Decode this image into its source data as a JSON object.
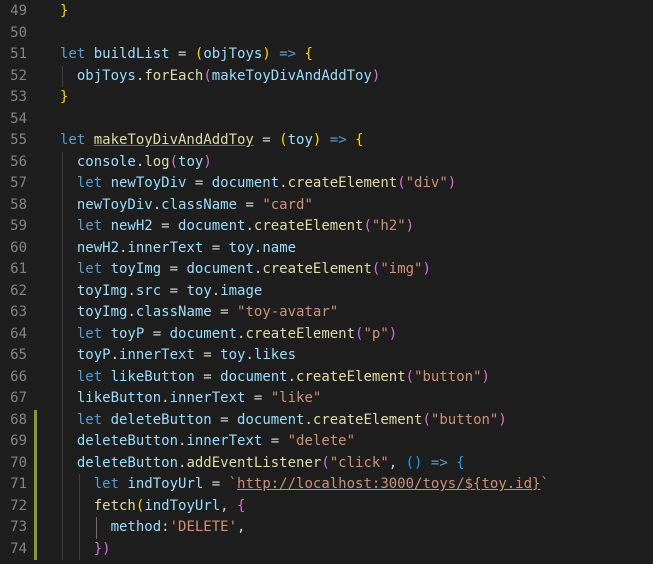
{
  "editor": {
    "lines": [
      {
        "num": "49",
        "top": "}",
        "parts": [
          [
            "br1",
            "}"
          ]
        ]
      },
      {
        "num": "50",
        "parts": []
      },
      {
        "num": "51",
        "parts": [
          [
            "kw",
            "let "
          ],
          [
            "var",
            "buildList"
          ],
          [
            "op",
            " = "
          ],
          [
            "br1",
            "("
          ],
          [
            "var",
            "objToys"
          ],
          [
            "br1",
            ")"
          ],
          [
            "op",
            " "
          ],
          [
            "kw",
            "=>"
          ],
          [
            "op",
            " "
          ],
          [
            "br1",
            "{"
          ]
        ]
      },
      {
        "num": "52",
        "parts": [
          [
            "op",
            "  "
          ],
          [
            "var",
            "objToys"
          ],
          [
            "op",
            "."
          ],
          [
            "fn",
            "forEach"
          ],
          [
            "br2",
            "("
          ],
          [
            "var",
            "makeToyDivAndAddToy"
          ],
          [
            "br2",
            ")"
          ]
        ]
      },
      {
        "num": "53",
        "parts": [
          [
            "br1",
            "}"
          ]
        ]
      },
      {
        "num": "54",
        "parts": []
      },
      {
        "num": "55",
        "parts": [
          [
            "kw",
            "let "
          ],
          [
            "fn ul",
            "makeToyDivAndAddToy"
          ],
          [
            "op",
            " = "
          ],
          [
            "br1",
            "("
          ],
          [
            "var",
            "toy"
          ],
          [
            "br1",
            ")"
          ],
          [
            "op",
            " "
          ],
          [
            "kw",
            "=>"
          ],
          [
            "op",
            " "
          ],
          [
            "br1",
            "{"
          ]
        ]
      },
      {
        "num": "56",
        "parts": [
          [
            "op",
            "  "
          ],
          [
            "var",
            "console"
          ],
          [
            "op",
            "."
          ],
          [
            "fn",
            "log"
          ],
          [
            "br2",
            "("
          ],
          [
            "var",
            "toy"
          ],
          [
            "br2",
            ")"
          ]
        ]
      },
      {
        "num": "57",
        "parts": [
          [
            "op",
            "  "
          ],
          [
            "kw",
            "let "
          ],
          [
            "var",
            "newToyDiv"
          ],
          [
            "op",
            " = "
          ],
          [
            "var",
            "document"
          ],
          [
            "op",
            "."
          ],
          [
            "fn",
            "createElement"
          ],
          [
            "br2",
            "("
          ],
          [
            "str",
            "\"div\""
          ],
          [
            "br2",
            ")"
          ]
        ]
      },
      {
        "num": "58",
        "parts": [
          [
            "op",
            "  "
          ],
          [
            "var",
            "newToyDiv"
          ],
          [
            "op",
            "."
          ],
          [
            "var",
            "className"
          ],
          [
            "op",
            " = "
          ],
          [
            "str",
            "\"card\""
          ]
        ]
      },
      {
        "num": "59",
        "parts": [
          [
            "op",
            "  "
          ],
          [
            "kw",
            "let "
          ],
          [
            "var",
            "newH2"
          ],
          [
            "op",
            " = "
          ],
          [
            "var",
            "document"
          ],
          [
            "op",
            "."
          ],
          [
            "fn",
            "createElement"
          ],
          [
            "br2",
            "("
          ],
          [
            "str",
            "\"h2\""
          ],
          [
            "br2",
            ")"
          ]
        ]
      },
      {
        "num": "60",
        "parts": [
          [
            "op",
            "  "
          ],
          [
            "var",
            "newH2"
          ],
          [
            "op",
            "."
          ],
          [
            "var",
            "innerText"
          ],
          [
            "op",
            " = "
          ],
          [
            "var",
            "toy"
          ],
          [
            "op",
            "."
          ],
          [
            "var",
            "name"
          ]
        ]
      },
      {
        "num": "61",
        "parts": [
          [
            "op",
            "  "
          ],
          [
            "kw",
            "let "
          ],
          [
            "var",
            "toyImg"
          ],
          [
            "op",
            " = "
          ],
          [
            "var",
            "document"
          ],
          [
            "op",
            "."
          ],
          [
            "fn",
            "createElement"
          ],
          [
            "br2",
            "("
          ],
          [
            "str",
            "\"img\""
          ],
          [
            "br2",
            ")"
          ]
        ]
      },
      {
        "num": "62",
        "parts": [
          [
            "op",
            "  "
          ],
          [
            "var",
            "toyImg"
          ],
          [
            "op",
            "."
          ],
          [
            "var",
            "src"
          ],
          [
            "op",
            " = "
          ],
          [
            "var",
            "toy"
          ],
          [
            "op",
            "."
          ],
          [
            "var",
            "image"
          ]
        ]
      },
      {
        "num": "63",
        "parts": [
          [
            "op",
            "  "
          ],
          [
            "var",
            "toyImg"
          ],
          [
            "op",
            "."
          ],
          [
            "var",
            "className"
          ],
          [
            "op",
            " = "
          ],
          [
            "str",
            "\"toy-avatar\""
          ]
        ]
      },
      {
        "num": "64",
        "parts": [
          [
            "op",
            "  "
          ],
          [
            "kw",
            "let "
          ],
          [
            "var",
            "toyP"
          ],
          [
            "op",
            " = "
          ],
          [
            "var",
            "document"
          ],
          [
            "op",
            "."
          ],
          [
            "fn",
            "createElement"
          ],
          [
            "br2",
            "("
          ],
          [
            "str",
            "\"p\""
          ],
          [
            "br2",
            ")"
          ]
        ]
      },
      {
        "num": "65",
        "parts": [
          [
            "op",
            "  "
          ],
          [
            "var",
            "toyP"
          ],
          [
            "op",
            "."
          ],
          [
            "var",
            "innerText"
          ],
          [
            "op",
            " = "
          ],
          [
            "var",
            "toy"
          ],
          [
            "op",
            "."
          ],
          [
            "var",
            "likes"
          ]
        ]
      },
      {
        "num": "66",
        "parts": [
          [
            "op",
            "  "
          ],
          [
            "kw",
            "let "
          ],
          [
            "var",
            "likeButton"
          ],
          [
            "op",
            " = "
          ],
          [
            "var",
            "document"
          ],
          [
            "op",
            "."
          ],
          [
            "fn",
            "createElement"
          ],
          [
            "br2",
            "("
          ],
          [
            "str",
            "\"button\""
          ],
          [
            "br2",
            ")"
          ]
        ]
      },
      {
        "num": "67",
        "parts": [
          [
            "op",
            "  "
          ],
          [
            "var",
            "likeButton"
          ],
          [
            "op",
            "."
          ],
          [
            "var",
            "innerText"
          ],
          [
            "op",
            " = "
          ],
          [
            "str",
            "\"like\""
          ]
        ]
      },
      {
        "num": "68",
        "parts": [
          [
            "op",
            "  "
          ],
          [
            "kw",
            "let "
          ],
          [
            "var",
            "deleteButton"
          ],
          [
            "op",
            " = "
          ],
          [
            "var",
            "document"
          ],
          [
            "op",
            "."
          ],
          [
            "fn",
            "createElement"
          ],
          [
            "br2",
            "("
          ],
          [
            "str",
            "\"button\""
          ],
          [
            "br2",
            ")"
          ]
        ]
      },
      {
        "num": "69",
        "parts": [
          [
            "op",
            "  "
          ],
          [
            "var",
            "deleteButton"
          ],
          [
            "op",
            "."
          ],
          [
            "var",
            "innerText"
          ],
          [
            "op",
            " = "
          ],
          [
            "str",
            "\"delete\""
          ]
        ]
      },
      {
        "num": "70",
        "parts": [
          [
            "op",
            "  "
          ],
          [
            "var",
            "deleteButton"
          ],
          [
            "op",
            "."
          ],
          [
            "fn",
            "addEventListener"
          ],
          [
            "br2",
            "("
          ],
          [
            "str",
            "\"click\""
          ],
          [
            "op",
            ", "
          ],
          [
            "br3",
            "()"
          ],
          [
            "op",
            " "
          ],
          [
            "kw",
            "=>"
          ],
          [
            "op",
            " "
          ],
          [
            "br3",
            "{"
          ]
        ]
      },
      {
        "num": "71",
        "parts": [
          [
            "op",
            "    "
          ],
          [
            "kw",
            "let "
          ],
          [
            "var",
            "indToyUrl"
          ],
          [
            "op",
            " = "
          ],
          [
            "str",
            "`"
          ],
          [
            "link",
            "http://localhost:3000/toys/${toy.id}"
          ],
          [
            "str",
            "`"
          ]
        ]
      },
      {
        "num": "72",
        "parts": [
          [
            "op",
            "    "
          ],
          [
            "fn",
            "fetch"
          ],
          [
            "br1",
            "("
          ],
          [
            "var",
            "indToyUrl"
          ],
          [
            "op",
            ", "
          ],
          [
            "br2",
            "{"
          ]
        ]
      },
      {
        "num": "73",
        "parts": [
          [
            "op",
            "      "
          ],
          [
            "var",
            "method"
          ],
          [
            "op",
            ":"
          ],
          [
            "str",
            "'DELETE'"
          ],
          [
            "op",
            ","
          ]
        ]
      },
      {
        "num": "74",
        "parts": [
          [
            "op",
            "    "
          ],
          [
            "br2",
            "})"
          ]
        ]
      }
    ],
    "modified_lines": [
      "68",
      "69",
      "70",
      "71",
      "72",
      "73",
      "74"
    ]
  }
}
